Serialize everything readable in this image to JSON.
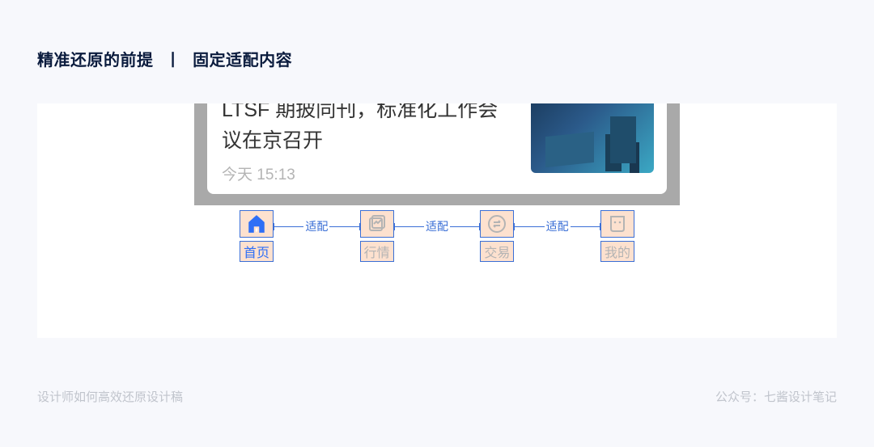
{
  "header": {
    "title_part1": "精准还原的前提",
    "title_part2": "固定适配内容"
  },
  "card": {
    "title": "LTSF 期披同刊，标准化工作会议在京召开",
    "time": "今天 15:13"
  },
  "spacer_label": "适配",
  "tabs": [
    {
      "label": "首页",
      "icon": "home-icon",
      "active": true
    },
    {
      "label": "行情",
      "icon": "market-icon",
      "active": false
    },
    {
      "label": "交易",
      "icon": "trade-icon",
      "active": false
    },
    {
      "label": "我的",
      "icon": "profile-icon",
      "active": false
    }
  ],
  "footer": {
    "left": "设计师如何高效还原设计稿",
    "right": "公众号：七酱设计笔记"
  }
}
